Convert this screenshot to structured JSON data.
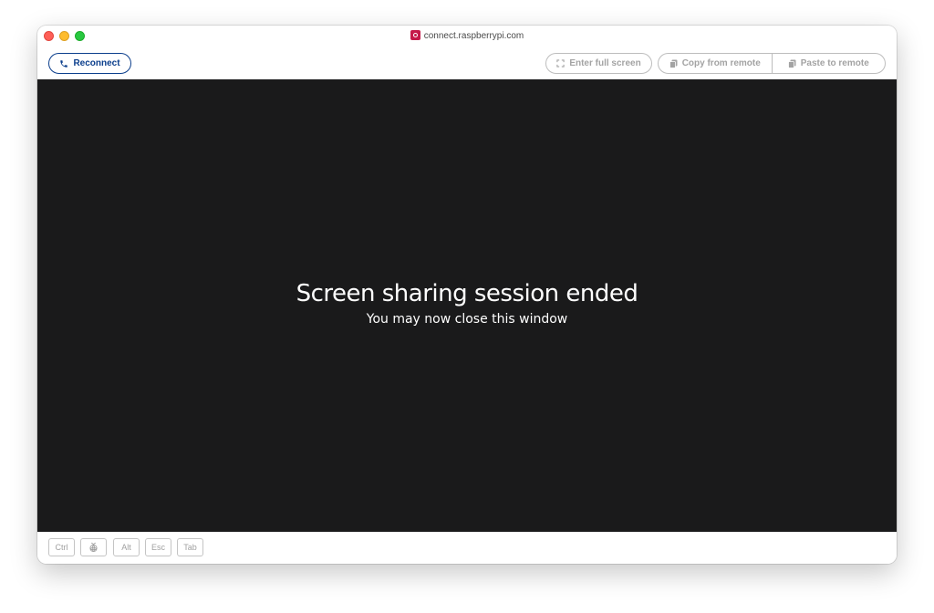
{
  "window": {
    "title": "connect.raspberrypi.com",
    "favicon": "raspberry-pi-connect-icon"
  },
  "toolbar": {
    "reconnect_label": "Reconnect",
    "reconnect_icon": "phone-icon",
    "fullscreen_label": "Enter full screen",
    "fullscreen_icon": "expand-icon",
    "copy_label": "Copy from remote",
    "copy_icon": "clipboard-icon",
    "paste_label": "Paste to remote",
    "paste_icon": "clipboard-icon"
  },
  "remote": {
    "title": "Screen sharing session ended",
    "subtitle": "You may now close this window"
  },
  "keys": {
    "ctrl": "Ctrl",
    "pi_icon": "raspberry-pi-icon",
    "alt": "Alt",
    "esc": "Esc",
    "tab": "Tab"
  },
  "colors": {
    "accent": "#0b3e8c",
    "remote_background": "#1a1a1b",
    "favicon": "#c51a4a",
    "disabled": "#a3a3a3"
  }
}
